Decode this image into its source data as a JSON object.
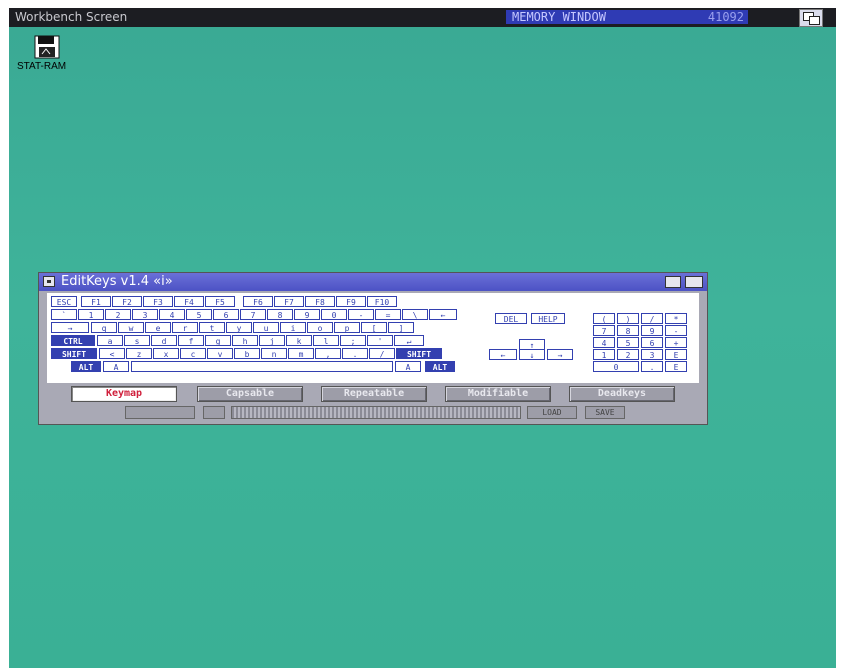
{
  "screen": {
    "title": "Workbench Screen",
    "memory_text": "MEMORY WINDOW",
    "memory_value": "41092"
  },
  "desktop": {
    "disk_label": "STAT-RAM"
  },
  "window": {
    "title": "EditKeys v1.4 «i»"
  },
  "keyboard": {
    "row_fn": [
      "ESC",
      "F1",
      "F2",
      "F3",
      "F4",
      "F5",
      "F6",
      "F7",
      "F8",
      "F9",
      "F10"
    ],
    "row_num": [
      "`",
      "1",
      "2",
      "3",
      "4",
      "5",
      "6",
      "7",
      "8",
      "9",
      "0",
      "-",
      "=",
      "\\",
      "←"
    ],
    "row_q": [
      "→",
      "q",
      "w",
      "e",
      "r",
      "t",
      "y",
      "u",
      "i",
      "o",
      "p",
      "[",
      "]"
    ],
    "row_a": [
      "CTRL",
      "a",
      "s",
      "d",
      "f",
      "g",
      "h",
      "j",
      "k",
      "l",
      ";",
      "'",
      "↵"
    ],
    "row_z": [
      "SHIFT",
      "<",
      "z",
      "x",
      "c",
      "v",
      "b",
      "n",
      "m",
      ",",
      ".",
      "/",
      "SHIFT"
    ],
    "row_sp": [
      "ALT",
      "A",
      "",
      "A",
      "ALT"
    ],
    "mid_keys": [
      "DEL",
      "HELP",
      "↑",
      "←",
      "↓",
      "→"
    ],
    "numpad": [
      "(",
      ")",
      "/",
      "*",
      "7",
      "8",
      "9",
      "-",
      "4",
      "5",
      "6",
      "+",
      "1",
      "2",
      "3",
      "E",
      "0",
      ".",
      "E"
    ]
  },
  "tabs": [
    "Keymap",
    "Capsable",
    "Repeatable",
    "Modifiable",
    "Deadkeys"
  ],
  "active_tab": "Keymap",
  "status_small": [
    "LOAD",
    "SAVE"
  ]
}
